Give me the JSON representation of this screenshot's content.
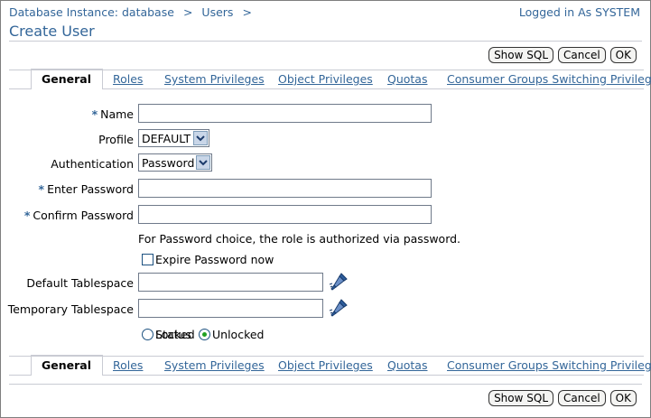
{
  "breadcrumb": {
    "items": [
      "Database Instance: database",
      "Users"
    ],
    "separator": ">"
  },
  "logged_in": "Logged in As SYSTEM",
  "page_title": "Create User",
  "buttons": {
    "show_sql": "Show SQL",
    "cancel": "Cancel",
    "ok": "OK"
  },
  "tabs": [
    {
      "label": "General",
      "active": true
    },
    {
      "label": "Roles",
      "active": false
    },
    {
      "label": "System Privileges",
      "active": false
    },
    {
      "label": "Object Privileges",
      "active": false
    },
    {
      "label": "Quotas",
      "active": false
    },
    {
      "label": "Consumer Groups Switching Privileges",
      "active": false
    }
  ],
  "form": {
    "required_marker": "*",
    "name_label": "Name",
    "name_value": "",
    "profile_label": "Profile",
    "profile_value": "DEFAULT",
    "auth_label": "Authentication",
    "auth_value": "Password",
    "enter_password_label": "Enter Password",
    "confirm_password_label": "Confirm Password",
    "password_note": "For Password choice, the role is authorized via password.",
    "expire_label": "Expire Password now",
    "expire_checked": false,
    "default_ts_label": "Default Tablespace",
    "temp_ts_label": "Temporary Tablespace",
    "status_label": "Status",
    "status_locked": "Locked",
    "status_unlocked": "Unlocked",
    "status_value": "Unlocked"
  },
  "colors": {
    "link": "#336699",
    "rule": "#c9cbd3",
    "radio_dot": "#21a121"
  },
  "icons": {
    "lov": "flashlight-search-icon",
    "dropdown": "chevron-down-icon"
  }
}
